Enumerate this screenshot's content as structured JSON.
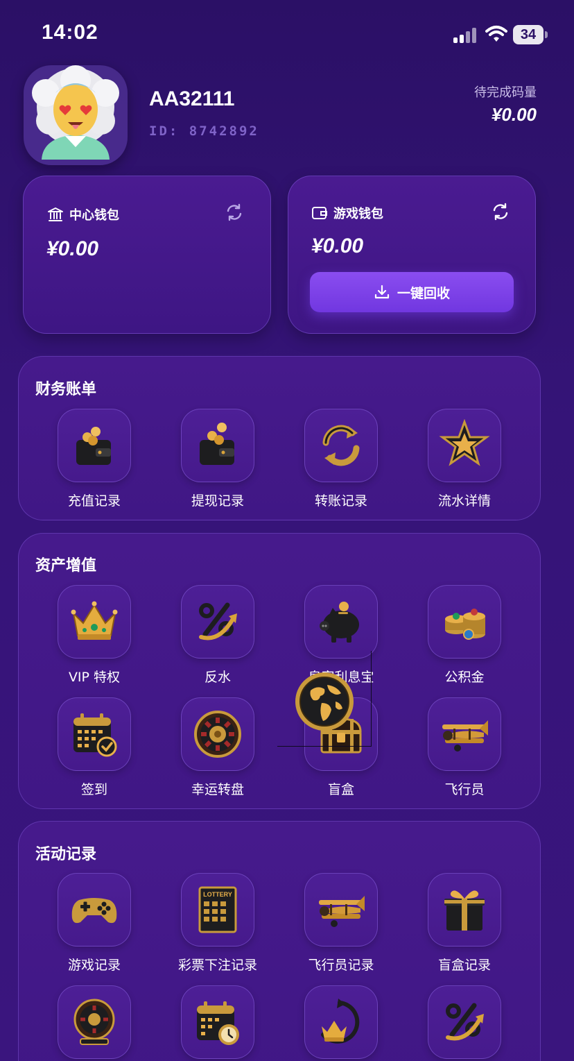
{
  "status_bar": {
    "time": "14:02",
    "battery": "34"
  },
  "profile": {
    "username": "AA32111",
    "user_id": "ID: 8742892",
    "pending_label": "待完成码量",
    "pending_value": "¥0.00"
  },
  "wallets": {
    "center": {
      "title": "中心钱包",
      "amount": "¥0.00"
    },
    "game": {
      "title": "游戏钱包",
      "amount": "¥0.00",
      "recycle_label": "一键回收"
    }
  },
  "sections": {
    "finance": {
      "title": "财务账单",
      "items": [
        {
          "label": "充值记录",
          "icon": "wallet-coins-icon"
        },
        {
          "label": "提现记录",
          "icon": "wallet-coins-icon"
        },
        {
          "label": "转账记录",
          "icon": "transfer-arrows-icon"
        },
        {
          "label": "流水详情",
          "icon": "star-badge-icon"
        }
      ]
    },
    "assets": {
      "title": "资产增值",
      "items": [
        {
          "label": "VIP 特权",
          "icon": "crown-icon"
        },
        {
          "label": "反水",
          "icon": "percent-arrow-icon"
        },
        {
          "label": "皇家利息宝",
          "icon": "piggy-bank-icon"
        },
        {
          "label": "公积金",
          "icon": "coin-stack-icon"
        },
        {
          "label": "签到",
          "icon": "calendar-check-icon"
        },
        {
          "label": "幸运转盘",
          "icon": "roulette-wheel-icon"
        },
        {
          "label": "盲盒",
          "icon": "treasure-chest-icon"
        },
        {
          "label": "飞行员",
          "icon": "biplane-icon"
        }
      ]
    },
    "activity": {
      "title": "活动记录",
      "items": [
        {
          "label": "游戏记录",
          "icon": "gamepad-icon"
        },
        {
          "label": "彩票下注记录",
          "icon": "lottery-ticket-icon"
        },
        {
          "label": "飞行员记录",
          "icon": "biplane-icon"
        },
        {
          "label": "盲盒记录",
          "icon": "gift-box-icon"
        },
        {
          "label": "",
          "icon": "roulette-wheel-icon"
        },
        {
          "label": "",
          "icon": "calendar-clock-icon"
        },
        {
          "label": "",
          "icon": "crown-cycle-icon"
        },
        {
          "label": "",
          "icon": "percent-arrow-icon"
        }
      ]
    }
  },
  "overlay": {
    "icon": "globe-icon"
  },
  "ticket_text": "LOTTERY"
}
